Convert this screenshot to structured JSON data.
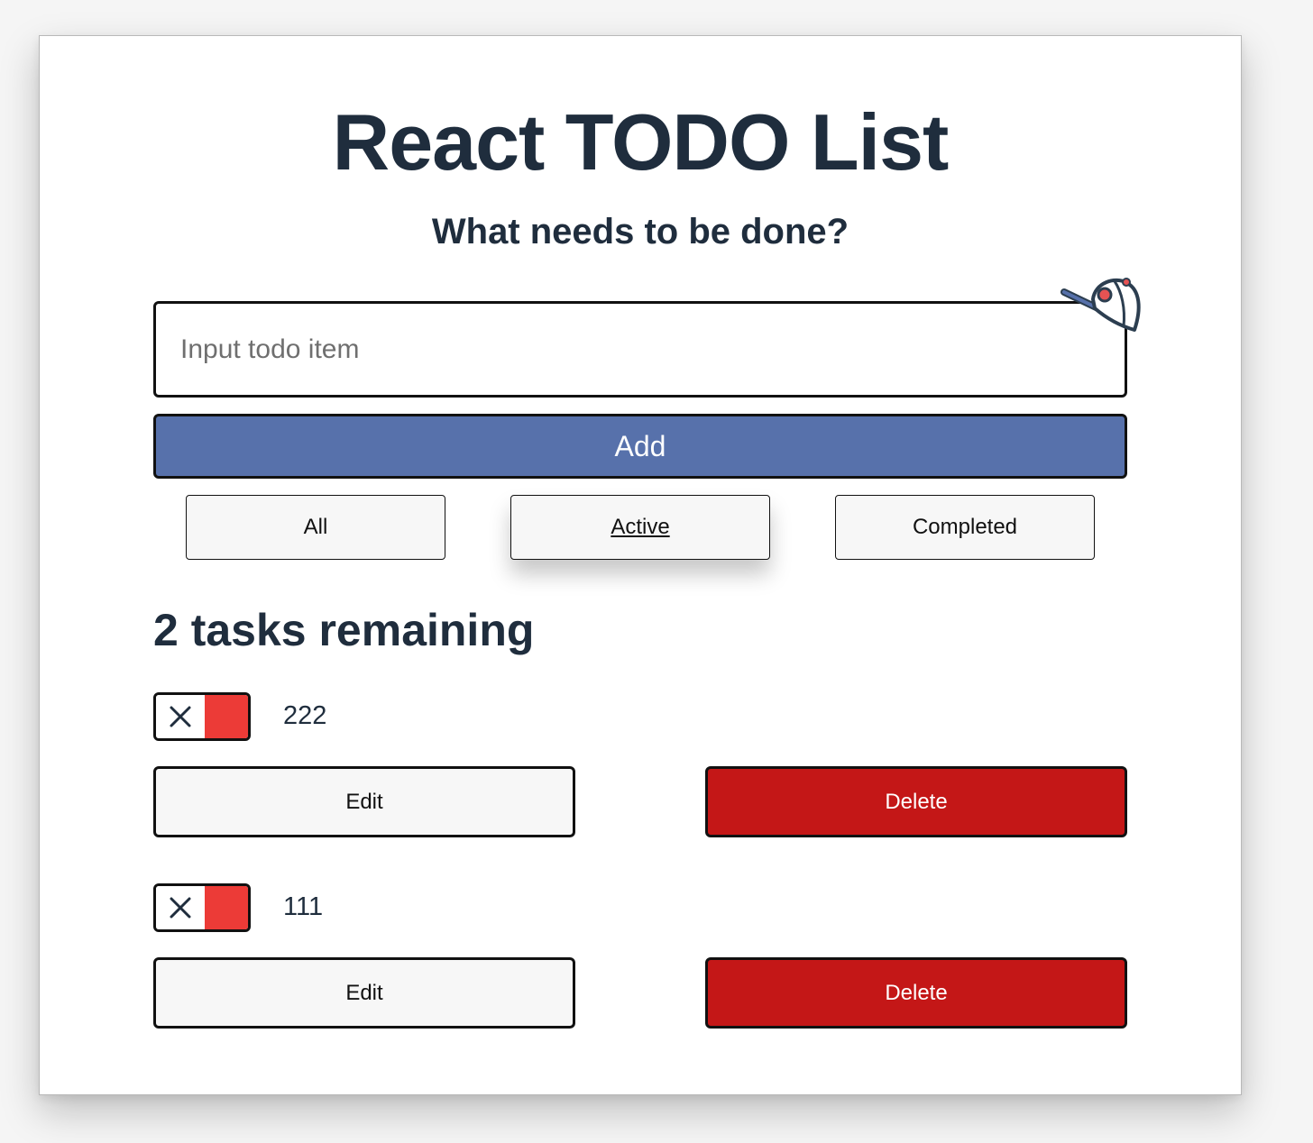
{
  "app": {
    "title": "React TODO List",
    "subtitle": "What needs to be done?"
  },
  "form": {
    "input_value": "",
    "input_placeholder": "Input todo item",
    "add_label": "Add"
  },
  "filters": {
    "items": [
      {
        "label": "All"
      },
      {
        "label": "Active",
        "selected": true
      },
      {
        "label": "Completed"
      }
    ]
  },
  "status": {
    "remaining_text": "2 tasks remaining"
  },
  "todos": [
    {
      "name": "222",
      "completed": false,
      "edit_label": "Edit",
      "delete_label": "Delete"
    },
    {
      "name": "111",
      "completed": false,
      "edit_label": "Edit",
      "delete_label": "Delete"
    }
  ],
  "icons": {
    "cap": "baseball-cap-icon",
    "toggle_off": "close-icon"
  },
  "colors": {
    "text": "#1f2d3d",
    "add_button": "#5771ab",
    "delete_button": "#c41717",
    "toggle_red": "#ec3b37",
    "neutral_button": "#f7f7f7"
  }
}
